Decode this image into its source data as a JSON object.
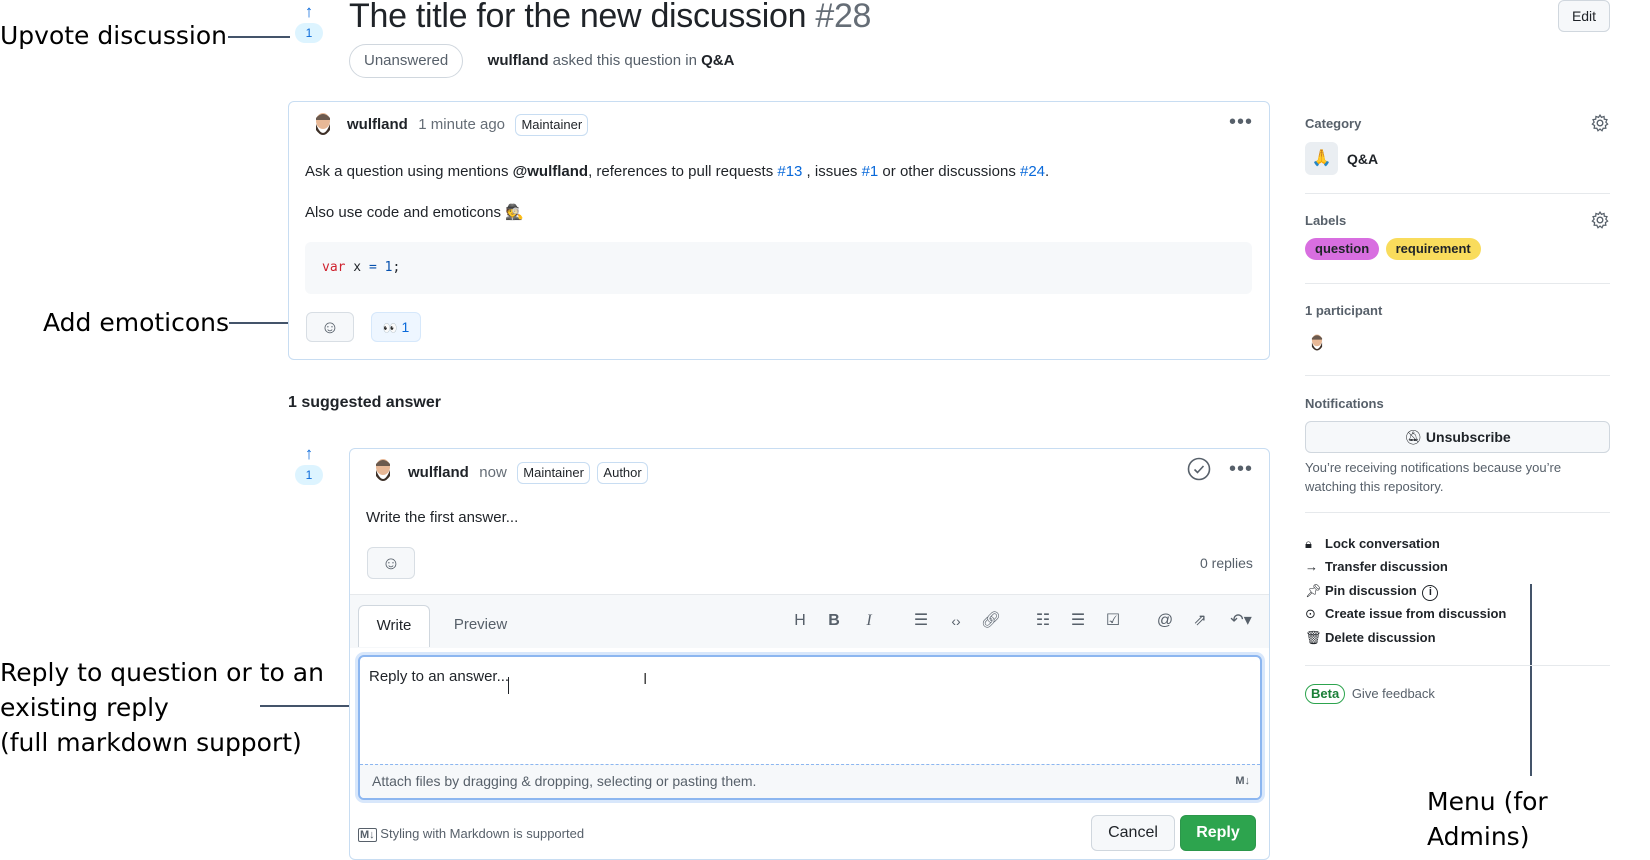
{
  "annotations": {
    "upvote": "Upvote discussion",
    "emoticons": "Add emoticons",
    "reply": [
      "Reply to question or to an",
      "existing reply",
      "(full markdown support)"
    ],
    "menu": "Menu (for Admins)"
  },
  "header": {
    "title": "The title for the new discussion",
    "number": "#28",
    "edit_label": "Edit",
    "status": "Unanswered",
    "author": "wulfland",
    "asked_text": "asked this question in",
    "category": "Q&A",
    "votes": "1"
  },
  "question": {
    "author": "wulfland",
    "time": "1 minute ago",
    "badge": "Maintainer",
    "line1": {
      "p1": "Ask a question using mentions ",
      "mention": "@wulfland",
      "p2": ", references to pull requests ",
      "pr": "#13",
      "p3": " , issues ",
      "issue": "#1",
      "p4": " or other discussions ",
      "disc": "#24",
      "p5": "."
    },
    "line2": "Also use code and emoticons",
    "code": {
      "kw": "var",
      "mid": " x ",
      "op": "=",
      "num": "1",
      "end": ";"
    },
    "reaction_emoji": "👀",
    "reaction_count": "1"
  },
  "answers": {
    "heading": "1 suggested answer",
    "votes": "1",
    "author": "wulfland",
    "time": "now",
    "badges": [
      "Maintainer",
      "Author"
    ],
    "body": "Write the first answer...",
    "replies": "0 replies"
  },
  "editor": {
    "tabs": [
      "Write",
      "Preview"
    ],
    "tools": [
      "heading-icon",
      "bold-icon",
      "italic-icon",
      "quote-icon",
      "code-icon",
      "link-icon",
      "unordered-list-icon",
      "ordered-list-icon",
      "task-list-icon",
      "mention-icon",
      "reference-icon",
      "reply-icon"
    ],
    "value": "Reply to an answer...",
    "attach_text": "Attach files by dragging & dropping, selecting or pasting them.",
    "markdown_note": "Styling with Markdown is supported",
    "cancel_label": "Cancel",
    "reply_label": "Reply"
  },
  "sidebar": {
    "category_heading": "Category",
    "category_emoji": "🙏",
    "category_name": "Q&A",
    "labels_heading": "Labels",
    "labels": [
      {
        "name": "question",
        "color": "#d86ee0"
      },
      {
        "name": "requirement",
        "color": "#f9dc5c"
      }
    ],
    "participants_heading": "1 participant",
    "notifications_heading": "Notifications",
    "unsubscribe_label": "Unsubscribe",
    "notifications_text": "You’re receiving notifications because you’re watching this repository.",
    "menu": [
      {
        "icon": "lock-icon",
        "label": "Lock conversation"
      },
      {
        "icon": "arrow-right-icon",
        "label": "Transfer discussion"
      },
      {
        "icon": "pin-icon",
        "label": "Pin discussion"
      },
      {
        "icon": "issue-opened-icon",
        "label": "Create issue from discussion"
      },
      {
        "icon": "trash-icon",
        "label": "Delete discussion"
      }
    ],
    "beta_label": "Beta",
    "feedback_label": "Give feedback"
  }
}
